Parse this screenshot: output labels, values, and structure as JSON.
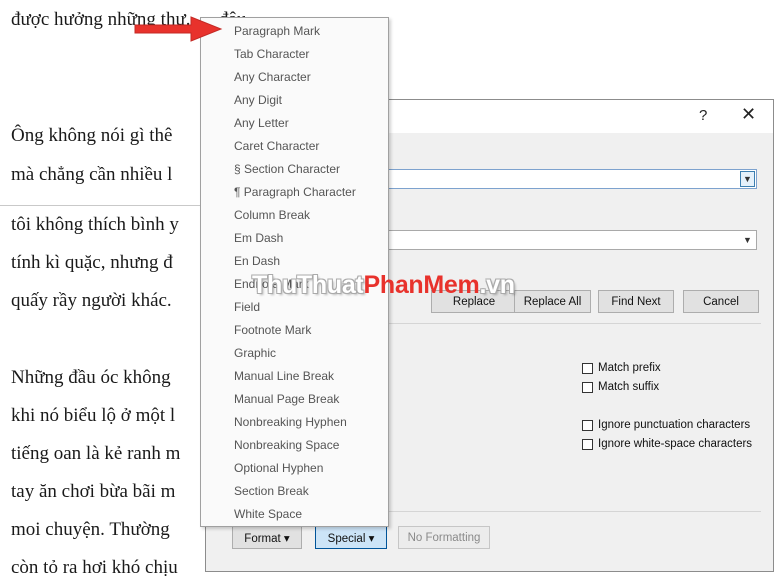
{
  "document": {
    "lines": [
      "được hưởng những thư... ...đâu.",
      "Ông không nói gì thê",
      "mà chẳng cần nhiều l",
      "tôi không thích bình y",
      "tính kì quặc, nhưng đ",
      "quấy rầy người khác.",
      "Những đầu óc không",
      "khi nó biểu lộ ở một l",
      "tiếng oan là kẻ ranh m",
      "tay ăn chơi bừa bãi m",
      "moi chuyện. Thường",
      "còn tỏ ra hơi khó chịu"
    ]
  },
  "dialog": {
    "help_label": "?",
    "close_label": "✕",
    "buttons": {
      "replace": "Replace",
      "replace_all": "Replace All",
      "find_next": "Find Next",
      "cancel": "Cancel",
      "format": "Format ▾",
      "special": "Special ▾",
      "no_formatting": "No Formatting"
    },
    "options": {
      "match_prefix": "Match prefix",
      "match_suffix": "Match suffix",
      "ignore_punctuation": "Ignore punctuation characters",
      "ignore_whitespace": "Ignore white-space characters"
    },
    "stray_text": ")"
  },
  "special_menu": {
    "items": [
      "Paragraph Mark",
      "Tab Character",
      "Any Character",
      "Any Digit",
      "Any Letter",
      "Caret Character",
      "§ Section Character",
      "¶ Paragraph Character",
      "Column Break",
      "Em Dash",
      "En Dash",
      "Endnote Mark",
      "Field",
      "Footnote Mark",
      "Graphic",
      "Manual Line Break",
      "Manual Page Break",
      "Nonbreaking Hyphen",
      "Nonbreaking Space",
      "Optional Hyphen",
      "Section Break",
      "White Space"
    ]
  },
  "watermark": {
    "part1": "ThuThuat",
    "part2": "PhanMem",
    "part3": ".vn"
  },
  "colors": {
    "arrow": "#e8322c",
    "special_button_bg": "#cce4f7",
    "combo_focus_border": "#7da2ce"
  },
  "icons": {
    "arrow": "red-arrow-icon",
    "combo_dropdown": "chevron-down-icon",
    "close": "close-icon",
    "help": "help-icon"
  }
}
